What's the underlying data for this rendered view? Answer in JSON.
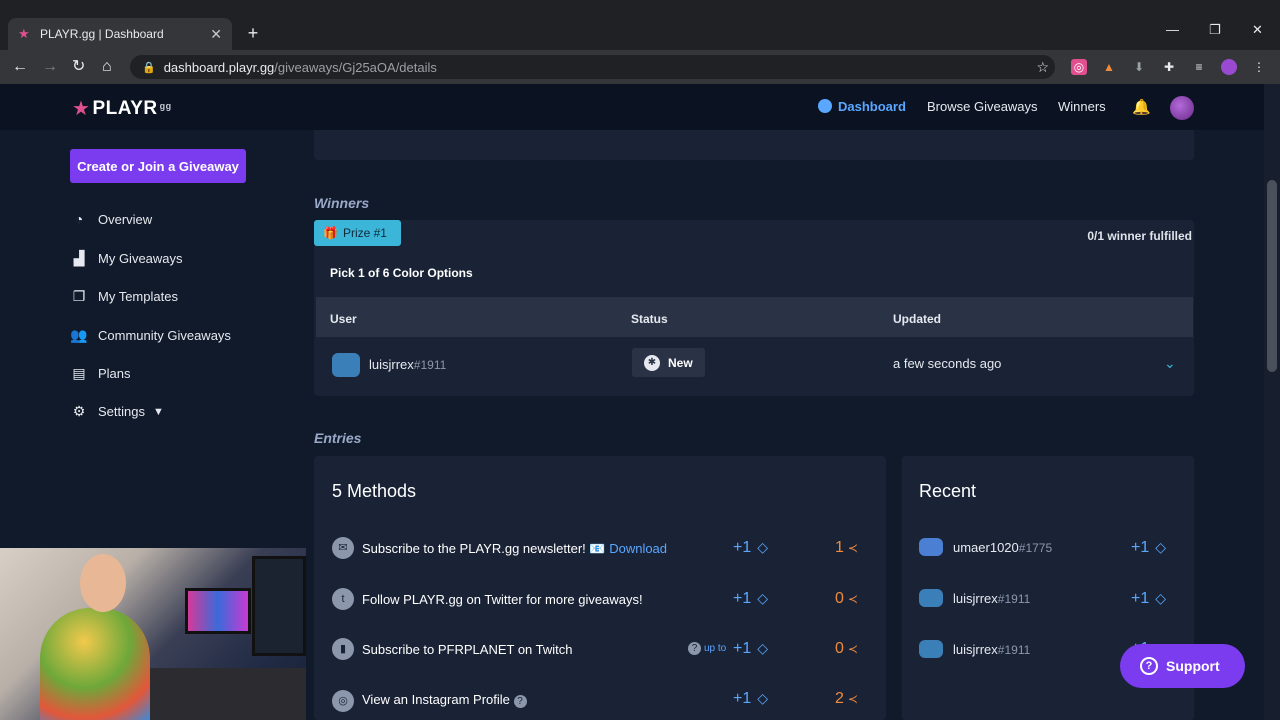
{
  "browser": {
    "tab_title": "PLAYR.gg | Dashboard",
    "url_host": "dashboard.playr.gg",
    "url_path": "/giveaways/Gj25aOA/details"
  },
  "header": {
    "logo_text": "PLAYR",
    "logo_suffix": "gg",
    "nav": [
      "Dashboard",
      "Browse Giveaways",
      "Winners"
    ]
  },
  "sidebar": {
    "cta_label": "Create or Join a Giveaway",
    "items": [
      "Overview",
      "My Giveaways",
      "My Templates",
      "Community Giveaways",
      "Plans",
      "Settings"
    ]
  },
  "winners": {
    "section_title": "Winners",
    "prize_label": "Prize #1",
    "fulfilled": "0/1 winner fulfilled",
    "prize_name": "Pick 1 of 6 Color Options",
    "columns": [
      "User",
      "Status",
      "Updated"
    ],
    "rows": [
      {
        "user": "luisjrrex",
        "discriminator": "#1911",
        "status": "New",
        "updated": "a few seconds ago"
      }
    ]
  },
  "entries": {
    "section_title": "Entries",
    "methods_title": "5 Methods",
    "methods": [
      {
        "icon": "mail-icon",
        "text": "Subscribe to the PLAYR.gg newsletter! 📧",
        "link": "Download",
        "points": "+1",
        "count": "1"
      },
      {
        "icon": "twitter-icon",
        "text": "Follow PLAYR.gg on Twitter for more giveaways!",
        "link": "",
        "points": "+1",
        "count": "0"
      },
      {
        "icon": "twitch-icon",
        "text": "Subscribe to PFRPLANET on Twitch",
        "link": "",
        "points": "+1",
        "count": "0",
        "upto": "up to"
      },
      {
        "icon": "instagram-icon",
        "text": "View an Instagram Profile",
        "link": "",
        "points": "+1",
        "count": "2"
      }
    ],
    "recent_title": "Recent",
    "recent": [
      {
        "user": "umaer1020",
        "discriminator": "#1775",
        "points": "+1"
      },
      {
        "user": "luisjrrex",
        "discriminator": "#1911",
        "points": "+1"
      },
      {
        "user": "luisjrrex",
        "discriminator": "#1911",
        "points": "+1"
      }
    ]
  },
  "support_label": "Support",
  "colors": {
    "accent": "#7b3cf0",
    "link": "#5aa7ff",
    "badge": "#3bb6d9",
    "count": "#f28a3b"
  }
}
